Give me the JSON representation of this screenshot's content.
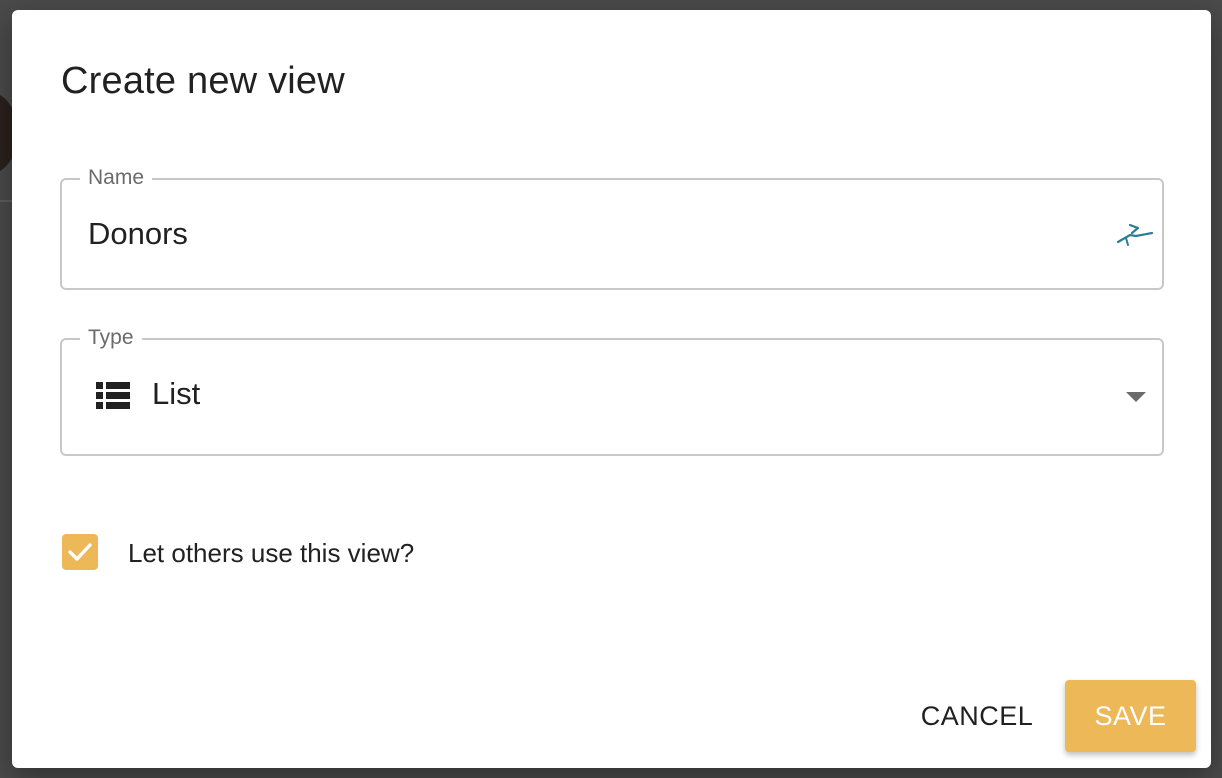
{
  "dialog": {
    "title": "Create new view"
  },
  "name_field": {
    "label": "Name",
    "value": "Donors",
    "icon": "extension-icon"
  },
  "type_field": {
    "label": "Type",
    "value": "List",
    "icon": "list-icon",
    "dropdown_icon": "caret-down-icon"
  },
  "share_option": {
    "label": "Let others use this view?",
    "checked": true
  },
  "actions": {
    "cancel_label": "CANCEL",
    "save_label": "SAVE"
  },
  "colors": {
    "accent": "#edb858",
    "text": "#212121",
    "label": "#6b6b6b",
    "border": "#c8c8c8",
    "backdrop": "#4a4a4a",
    "extension_icon": "#2a7d93"
  }
}
